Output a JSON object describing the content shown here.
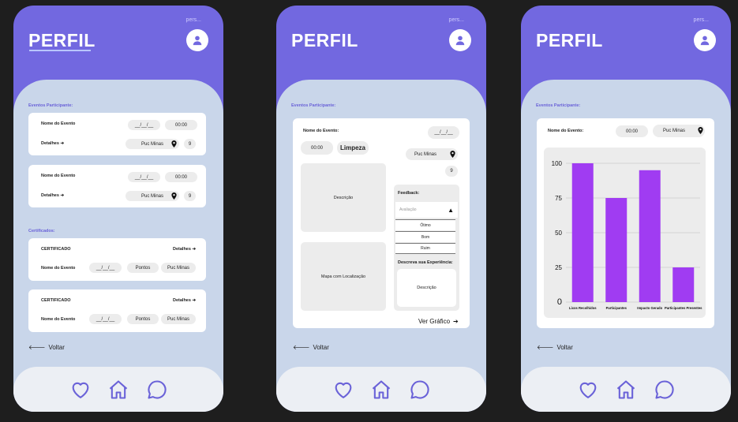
{
  "common": {
    "title": "PERFIL",
    "pers": "pers...",
    "back_label": "Voltar",
    "section_events": "Eventos Participante:"
  },
  "screen1": {
    "section_certificates": "Certificados:",
    "events": [
      {
        "name": "Nome do Evento",
        "date": "__/__/__",
        "time": "00:00",
        "details": "Detalhes",
        "location": "Puc Minas",
        "count": "9"
      },
      {
        "name": "Nome do Evento",
        "date": "__/__/__",
        "time": "00:00",
        "details": "Detalhes",
        "location": "Puc Minas",
        "count": "9"
      }
    ],
    "certificates": [
      {
        "title": "CERTIFICADO",
        "details": "Detalhes",
        "name": "Nome do Evento",
        "date": "__/__/__",
        "points": "Pontos",
        "location": "Puc Minas"
      },
      {
        "title": "CERTIFICADO",
        "details": "Detalhes",
        "name": "Nome do Evento",
        "date": "__/__/__",
        "points": "Pontos",
        "location": "Puc Minas"
      }
    ]
  },
  "screen2": {
    "event_name": "Nome do Evento:",
    "date": "__/__/__",
    "time": "00:00",
    "category": "Limpeza",
    "location": "Puc Minas",
    "count": "9",
    "description": "Descrição",
    "map": "Mapa com Localização",
    "feedback_label": "Feedback:",
    "rating_placeholder": "Avaliação",
    "options": [
      "Ótimo",
      "Bom",
      "Ruim"
    ],
    "experience_label": "Descreva sua Experiência:",
    "experience_placeholder": "Descrição",
    "chart_link": "Ver Gráfico"
  },
  "screen3": {
    "event_name": "Nome do Evento:",
    "time": "00:00",
    "location": "Puc Minas"
  },
  "chart_data": {
    "type": "bar",
    "categories": [
      "Lixos Recolhidos",
      "Participantes",
      "Impacto Gerado",
      "Participantes Presentes"
    ],
    "values": [
      100,
      75,
      95,
      25
    ],
    "ylim": [
      0,
      100
    ],
    "yticks": [
      "0",
      "25",
      "50",
      "75",
      "100"
    ],
    "grid": true,
    "bar_color": "#a03cf2"
  },
  "colors": {
    "header": "#7268e0",
    "body": "#c9d6ea",
    "accent": "#6a62d8"
  }
}
